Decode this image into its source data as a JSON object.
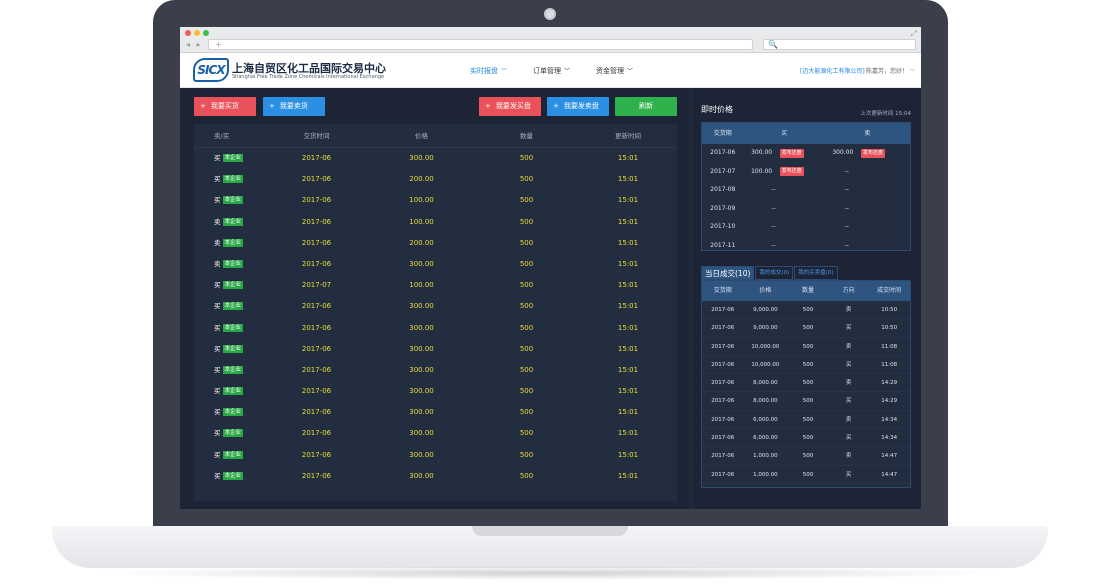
{
  "browser": {
    "nav_arrows": "◂ ▸",
    "url_plus": "+",
    "search_icon": "🔍"
  },
  "header": {
    "logo_mark": "SICX",
    "logo_title": "上海自贸区化工品国际交易中心",
    "logo_subtitle": "Shanghai Free Trade Zone Chemicals International Exchange",
    "nav": [
      {
        "label": "实时报盘",
        "active": true
      },
      {
        "label": "订单管理",
        "active": false
      },
      {
        "label": "资金管理",
        "active": false
      }
    ],
    "company": "[迈大能源化工有限公司]",
    "greeting": "陈嘉芳，您好！"
  },
  "actions": {
    "buy_goods": "我要买货",
    "sell_goods": "我要卖货",
    "post_buy": "我要发买盘",
    "post_sell": "我要发卖盘",
    "refresh": "刷新"
  },
  "orders": {
    "columns": [
      "卖/买",
      "交货时间",
      "价格",
      "数量",
      "更新时间"
    ],
    "own_tag": "本企业",
    "rows": [
      {
        "side": "买",
        "date": "2017-06",
        "price": "300.00",
        "qty": "500",
        "time": "15:01"
      },
      {
        "side": "买",
        "date": "2017-06",
        "price": "200.00",
        "qty": "500",
        "time": "15:01"
      },
      {
        "side": "买",
        "date": "2017-06",
        "price": "100.00",
        "qty": "500",
        "time": "15:01"
      },
      {
        "side": "卖",
        "date": "2017-06",
        "price": "100.00",
        "qty": "500",
        "time": "15:01"
      },
      {
        "side": "卖",
        "date": "2017-06",
        "price": "200.00",
        "qty": "500",
        "time": "15:01"
      },
      {
        "side": "卖",
        "date": "2017-06",
        "price": "300.00",
        "qty": "500",
        "time": "15:01"
      },
      {
        "side": "买",
        "date": "2017-07",
        "price": "100.00",
        "qty": "500",
        "time": "15:01"
      },
      {
        "side": "买",
        "date": "2017-06",
        "price": "300.00",
        "qty": "500",
        "time": "15:01"
      },
      {
        "side": "买",
        "date": "2017-06",
        "price": "300.00",
        "qty": "500",
        "time": "15:01"
      },
      {
        "side": "买",
        "date": "2017-06",
        "price": "300.00",
        "qty": "500",
        "time": "15:01"
      },
      {
        "side": "买",
        "date": "2017-06",
        "price": "300.00",
        "qty": "500",
        "time": "15:01"
      },
      {
        "side": "买",
        "date": "2017-06",
        "price": "300.00",
        "qty": "500",
        "time": "15:01"
      },
      {
        "side": "买",
        "date": "2017-06",
        "price": "300.00",
        "qty": "500",
        "time": "15:01"
      },
      {
        "side": "买",
        "date": "2017-06",
        "price": "300.00",
        "qty": "500",
        "time": "15:01"
      },
      {
        "side": "买",
        "date": "2017-06",
        "price": "300.00",
        "qty": "500",
        "time": "15:01"
      },
      {
        "side": "买",
        "date": "2017-06",
        "price": "300.00",
        "qty": "500",
        "time": "15:01"
      }
    ]
  },
  "realtime": {
    "title": "即时价格",
    "updated": "上次更新时间 15:04",
    "columns": [
      "交货期",
      "买",
      "卖"
    ],
    "counter_label": "发布还盘",
    "rows": [
      {
        "period": "2017-06",
        "buy": "300.00",
        "buy_counter": true,
        "sell": "300.00",
        "sell_counter": true
      },
      {
        "period": "2017-07",
        "buy": "100.00",
        "buy_counter": true,
        "sell": "--",
        "sell_counter": false
      },
      {
        "period": "2017-08",
        "buy": "--",
        "buy_counter": false,
        "sell": "--",
        "sell_counter": false
      },
      {
        "period": "2017-09",
        "buy": "--",
        "buy_counter": false,
        "sell": "--",
        "sell_counter": false
      },
      {
        "period": "2017-10",
        "buy": "--",
        "buy_counter": false,
        "sell": "--",
        "sell_counter": false
      },
      {
        "period": "2017-11",
        "buy": "--",
        "buy_counter": false,
        "sell": "--",
        "sell_counter": false
      }
    ]
  },
  "trades": {
    "tabs": [
      "当日成交(10)",
      "我的成交(0)",
      "我的买卖盘(0)"
    ],
    "columns": [
      "交货期",
      "价格",
      "数量",
      "方向",
      "成交时间"
    ],
    "rows": [
      {
        "period": "2017-06",
        "price": "9,000.00",
        "qty": "500",
        "dir": "卖",
        "time": "10:50"
      },
      {
        "period": "2017-06",
        "price": "9,000.00",
        "qty": "500",
        "dir": "买",
        "time": "10:50"
      },
      {
        "period": "2017-06",
        "price": "10,000.00",
        "qty": "500",
        "dir": "卖",
        "time": "11:08"
      },
      {
        "period": "2017-06",
        "price": "10,000.00",
        "qty": "500",
        "dir": "买",
        "time": "11:08"
      },
      {
        "period": "2017-06",
        "price": "8,000.00",
        "qty": "500",
        "dir": "卖",
        "time": "14:29"
      },
      {
        "period": "2017-06",
        "price": "8,000.00",
        "qty": "500",
        "dir": "买",
        "time": "14:29"
      },
      {
        "period": "2017-06",
        "price": "6,000.00",
        "qty": "500",
        "dir": "卖",
        "time": "14:34"
      },
      {
        "period": "2017-06",
        "price": "6,000.00",
        "qty": "500",
        "dir": "买",
        "time": "14:34"
      },
      {
        "period": "2017-06",
        "price": "1,000.00",
        "qty": "500",
        "dir": "卖",
        "time": "14:47"
      },
      {
        "period": "2017-06",
        "price": "1,000.00",
        "qty": "500",
        "dir": "买",
        "time": "14:47"
      }
    ]
  }
}
